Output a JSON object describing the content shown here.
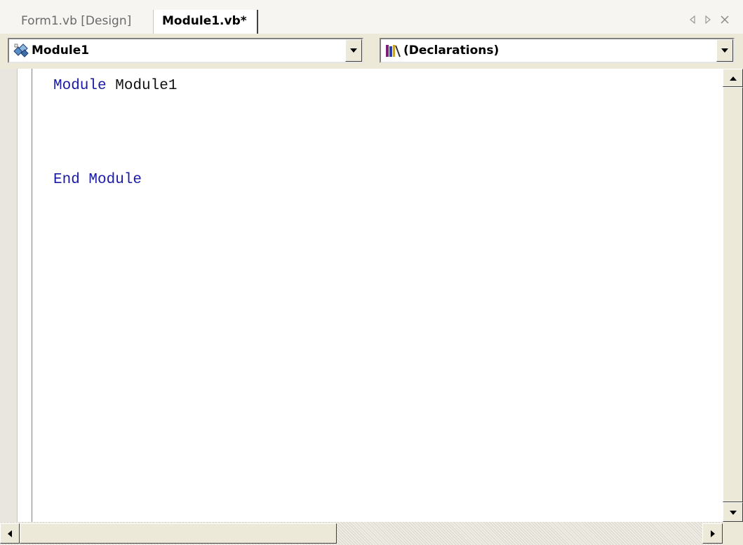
{
  "tabs": [
    {
      "label": "Form1.vb [Design]",
      "active": false
    },
    {
      "label": "Module1.vb*",
      "active": true
    }
  ],
  "tab_controls": {
    "prev_icon": "left-triangle",
    "next_icon": "right-triangle",
    "close_icon": "x"
  },
  "nav": {
    "class_combo": {
      "value": "Module1",
      "icon": "module-icon"
    },
    "member_combo": {
      "value": "(Declarations)",
      "icon": "declarations-icon"
    }
  },
  "editor": {
    "lines": [
      {
        "keyword": "Module",
        "identifier": "Module1"
      },
      {
        "keyword": "",
        "identifier": ""
      },
      {
        "keyword": "",
        "identifier": ""
      },
      {
        "keyword": "",
        "identifier": ""
      },
      {
        "keyword": "",
        "identifier": ""
      },
      {
        "keyword": "End Module",
        "identifier": ""
      }
    ]
  },
  "colors": {
    "keyword": "#1a1aa6",
    "identifier": "#111111",
    "chrome": "#ece9d8"
  }
}
